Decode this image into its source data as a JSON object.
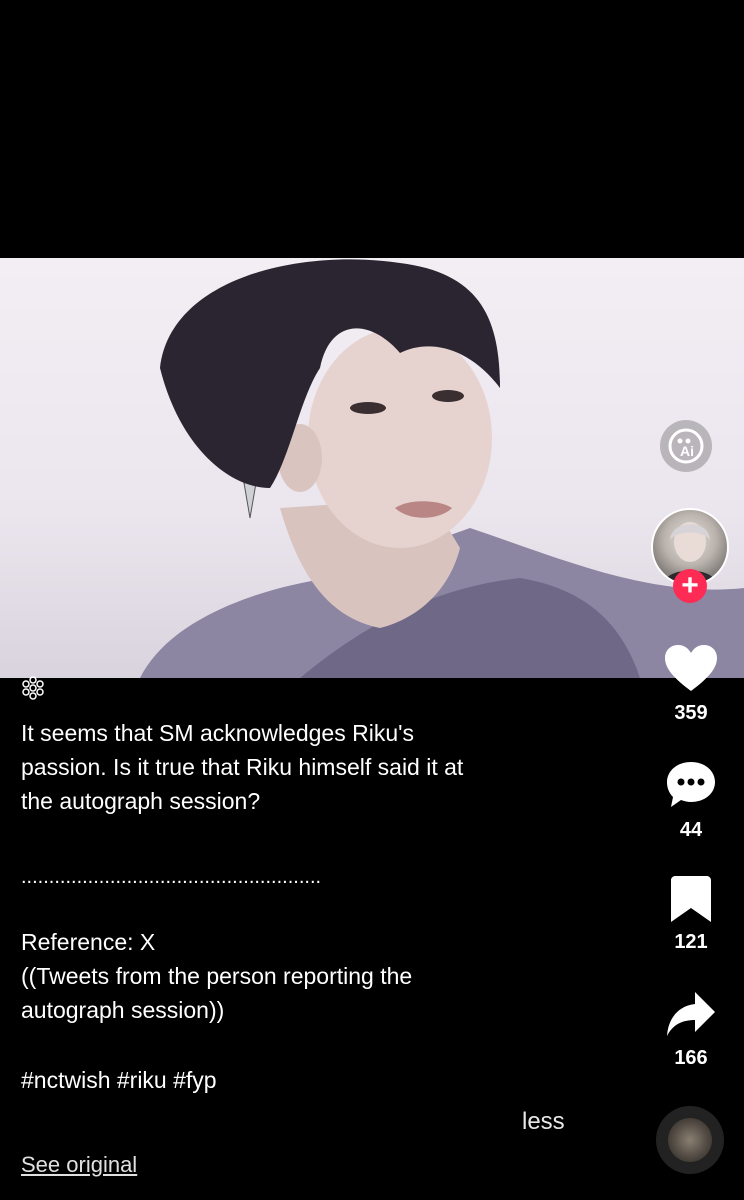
{
  "caption": {
    "line1": "It seems that SM acknowledges Riku's",
    "line2": "passion. Is it true that Riku himself said it at",
    "line3": "the autograph session?",
    "divider": "......................................................",
    "ref1": "Reference: X",
    "ref2": "((Tweets from the person reporting the",
    "ref3": "autograph session))",
    "hashtags": "#nctwish #riku #fyp"
  },
  "actions": {
    "likes": "359",
    "comments": "44",
    "saves": "121",
    "shares": "166"
  },
  "links": {
    "less": "less",
    "see_original": "See original"
  },
  "icons": {
    "ai": "ai-icon",
    "follow": "plus-icon",
    "like": "heart-icon",
    "comment": "comment-icon",
    "save": "bookmark-icon",
    "share": "share-icon",
    "music": "music-disc-icon",
    "decor": "snowflake-icon"
  },
  "colors": {
    "follow": "#fe2c55",
    "background": "#000000"
  },
  "follow_label": "+"
}
